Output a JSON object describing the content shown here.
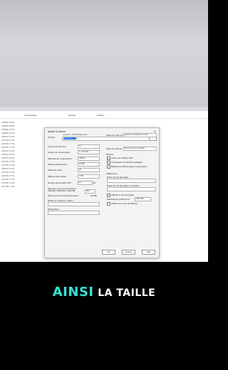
{
  "explorer": {
    "columns": [
      "Commentaire",
      "Dossier",
      "Fichiers"
    ],
    "rows": [
      "1/08/19 11:28",
      "1/08/20 09:55",
      "1/08/20 16:03",
      "1/08/20 16:04",
      "1/08/19 11:28",
      "1/07/25 17:52",
      "1/07/25 17:52",
      "1/07/25 17:52",
      "1/08/14 12:52",
      "1/08/14 12:52",
      "1/08/14 12:52",
      "1/07/25 17:52",
      "1/07/25 17:52",
      "1/08/14 12:52",
      "1/07/25 17:52",
      "1/07/25 17:52",
      "1/07/25 17:52",
      "1/07/25 17:52",
      "1/07/25 17:52"
    ]
  },
  "dialog": {
    "title": "Ajouter à l'archive",
    "close": "✕",
    "archive_label": "Archive :",
    "archive_path": "C:\\Users\\...\\Téléchargements\\",
    "archive_name": "Dat (Pixels) .7z",
    "format_label": "Format de l'archive :",
    "format_value": "7z",
    "level_label": "Niveau de compression :",
    "level_value": "5 - Normale",
    "method_label": "Méthode de compression :",
    "method_value": "LZMA2",
    "dict_label": "Taille du dictionnaire :",
    "dict_value": "16 MB",
    "word_label": "Taille des mots :",
    "word_value": "32",
    "block_label": "Taille de bloc solide :",
    "block_value": "4 GB",
    "threads_label": "Nombre de threads CPU :",
    "threads_value": "16",
    "threads_max": "/ 16",
    "mem_comp_label": "Mémoire pour la compression :",
    "mem_comp_value": "2496 MB / 16209 MB / 15122 MB",
    "mem_comp_pct": "80%",
    "mem_decomp_label": "Mémoire pour la décompression :",
    "mem_decomp_value": "18 MB",
    "split_label": "Diviser en volumes, octets :",
    "params_label": "Paramètres :",
    "update_label": "Mode de mise à jour :",
    "update_value": "Ajouter et remplacer les fich",
    "path_label": "Mode de chemin :",
    "path_value": "Noms de chemin relatifs",
    "options_label": "Options",
    "opt_sfx": "Créer une archive SFX",
    "opt_shared": "Compresser les fichiers partagés",
    "opt_delete": "Effacer les fichiers après compression",
    "encrypt_label": "Chiffrement",
    "pwd_label": "Entrer le mot de passe :",
    "pwd_again_label": "Entrer le mot de passe à nouveau :",
    "show_pwd": "Afficher le mot de passe",
    "enc_method_label": "Méthode de chiffrement :",
    "enc_method_value": "AES-256",
    "enc_names": "Chiffrer les noms de fichiers",
    "ok": "OK",
    "cancel": "Annuler",
    "help": "Aide"
  },
  "caption": {
    "word1": "AINSI",
    "word2": "LA TAILLE"
  }
}
